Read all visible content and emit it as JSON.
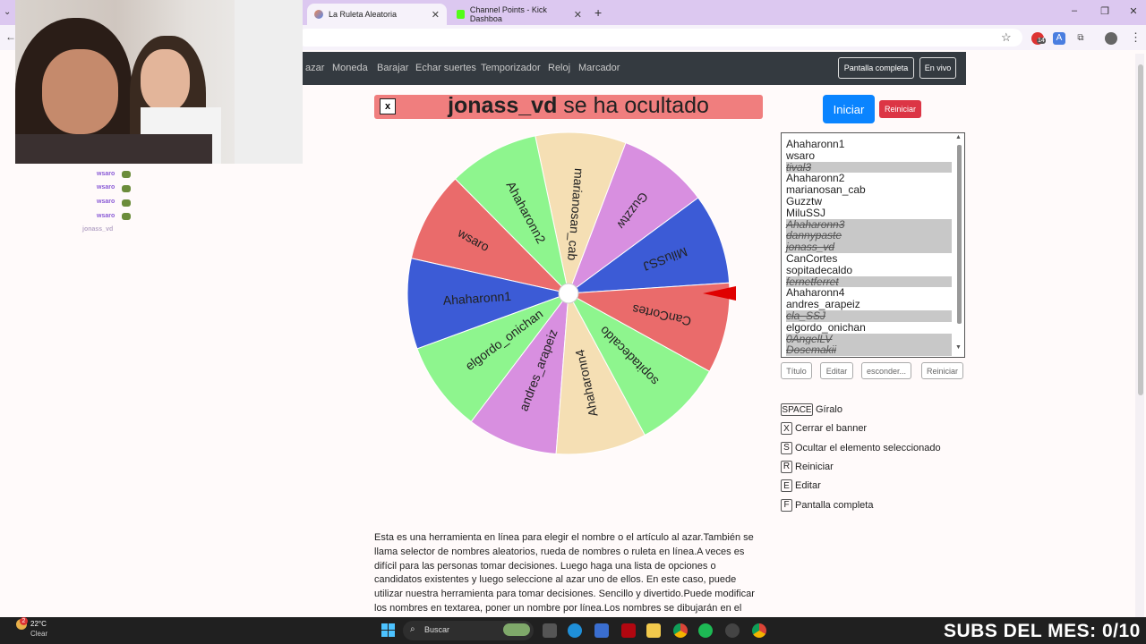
{
  "browser": {
    "tabs": [
      {
        "title": "La Ruleta Aleatoria",
        "active": true
      },
      {
        "title": "Channel Points - Kick Dashboa",
        "active": false
      }
    ],
    "new_tab": "+",
    "window_controls": {
      "minimize": "–",
      "restore": "❐",
      "close": "✕"
    },
    "ext_badge": "14"
  },
  "nav": {
    "links": [
      "azar",
      "Moneda",
      "Barajar",
      "Echar suertes",
      "Temporizador",
      "Reloj",
      "Marcador"
    ],
    "fullscreen": "Pantalla completa",
    "live": "En vivo"
  },
  "banner": {
    "close": "x",
    "name": "jonass_vd",
    "suffix": " se ha ocultado"
  },
  "controls": {
    "start": "Iniciar",
    "reset": "Reiniciar"
  },
  "names": [
    {
      "text": "Ahaharonn1",
      "hidden": false
    },
    {
      "text": "wsaro",
      "hidden": false
    },
    {
      "text": "tival3",
      "hidden": true
    },
    {
      "text": "Ahaharonn2",
      "hidden": false
    },
    {
      "text": "marianosan_cab",
      "hidden": false
    },
    {
      "text": "Guzztw",
      "hidden": false
    },
    {
      "text": "MiluSSJ",
      "hidden": false
    },
    {
      "text": "Ahaharonn3",
      "hidden": true
    },
    {
      "text": "dannypaste",
      "hidden": true
    },
    {
      "text": "jonass_vd",
      "hidden": true
    },
    {
      "text": "CanCortes",
      "hidden": false
    },
    {
      "text": "sopitadecaldo",
      "hidden": false
    },
    {
      "text": "fernetferret",
      "hidden": true
    },
    {
      "text": "Ahaharonn4",
      "hidden": false
    },
    {
      "text": "andres_arapeiz",
      "hidden": false
    },
    {
      "text": "cla_SSJ",
      "hidden": true
    },
    {
      "text": "elgordo_onichan",
      "hidden": false
    },
    {
      "text": "0AngelLV",
      "hidden": true
    },
    {
      "text": "Dosemakii",
      "hidden": true
    }
  ],
  "list_buttons": [
    "Título",
    "Editar",
    "esconder...",
    "Reiniciar"
  ],
  "shortcuts": [
    {
      "key": "SPACE",
      "desc": "Gíralo"
    },
    {
      "key": "X",
      "desc": "Cerrar el banner"
    },
    {
      "key": "S",
      "desc": "Ocultar el elemento seleccionado"
    },
    {
      "key": "R",
      "desc": "Reiniciar"
    },
    {
      "key": "E",
      "desc": "Editar"
    },
    {
      "key": "F",
      "desc": "Pantalla completa"
    }
  ],
  "wheel": {
    "segments": [
      {
        "label": "MiluSSJ",
        "color": "#3c5bd6"
      },
      {
        "label": "Guzztw",
        "color": "#d88fe0"
      },
      {
        "label": "marianosan_cab",
        "color": "#f5dfb4"
      },
      {
        "label": "Ahaharonn2",
        "color": "#8ef58e"
      },
      {
        "label": "wsaro",
        "color": "#ea6b6b"
      },
      {
        "label": "Ahaharonn1",
        "color": "#3c5bd6"
      },
      {
        "label": "elgordo_onichan",
        "color": "#8ef58e"
      },
      {
        "label": "andres_arapeiz",
        "color": "#d88fe0"
      },
      {
        "label": "Ahaharonn4",
        "color": "#f5dfb4"
      },
      {
        "label": "sopitadecaldo",
        "color": "#8ef58e"
      },
      {
        "label": "CanCortes",
        "color": "#ea6b6b"
      }
    ],
    "pointer_color": "#e00000"
  },
  "description": "Esta es una herramienta en línea para elegir el nombre o el artículo al azar.También se llama selector de nombres aleatorios, rueda de nombres o ruleta en línea.A veces es difícil para las personas tomar decisiones. Luego haga una lista de opciones o candidatos existentes y luego seleccione al azar uno de ellos. En este caso, puede utilizar nuestra herramienta para tomar decisiones. Sencillo y divertido.Puede modificar los nombres en textarea, poner un nombre por línea.Los nombres se dibujarán en el círculo.Simplemente haga clic en la rueda",
  "stream_chat": [
    "wsaro",
    "wsaro",
    "wsaro",
    "wsaro",
    "jonass_vd"
  ],
  "taskbar": {
    "temp": "22°C",
    "weather": "Clear",
    "weather_badge": "2",
    "search": "Buscar",
    "overlay": "SUBS DEL MES: 0/10"
  }
}
